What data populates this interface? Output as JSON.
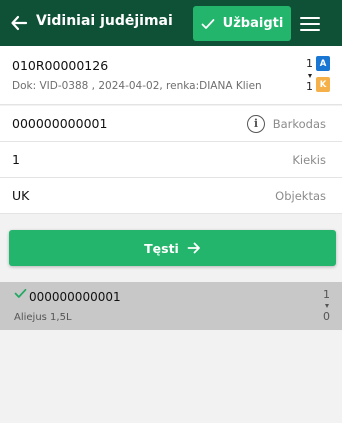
{
  "header": {
    "title": "Vidiniai judėjimai",
    "finish_label": "Užbaigti",
    "background": "#0f5136",
    "accent": "#22b56b"
  },
  "document": {
    "code": "010R00000126",
    "meta": "Dok: VID-0388 , 2024-04-02, renka:DIANA Klien",
    "count_top": "1",
    "count_bottom": "1",
    "badge_a": "A",
    "badge_k": "K",
    "badge_a_color": "#1976d2",
    "badge_k_color": "#f5b04a"
  },
  "fields": {
    "barcode_value": "000000000001",
    "barcode_label": "Barkodas",
    "quantity_value": "1",
    "quantity_label": "Kiekis",
    "object_value": "UK",
    "object_label": "Objektas"
  },
  "submit": {
    "label": "Tęsti"
  },
  "items": [
    {
      "code": "000000000001",
      "name": "Aliejus 1,5L",
      "count_top": "1",
      "count_bottom": "0"
    }
  ]
}
